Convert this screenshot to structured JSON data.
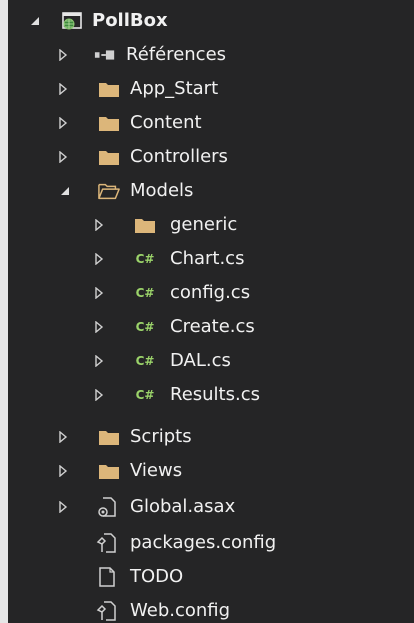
{
  "colors": {
    "background": "#252526",
    "text": "#f1f1f1",
    "folder": "#dcb67a",
    "csharp": "#9bd36a",
    "glyph": "#d0d0d0"
  },
  "tree": {
    "root": {
      "label": "PollBox",
      "icon": "web-project-icon",
      "expanded": true
    },
    "items": [
      {
        "label": "Références",
        "icon": "references-icon",
        "expanded": false
      },
      {
        "label": "App_Start",
        "icon": "folder-icon",
        "expanded": false
      },
      {
        "label": "Content",
        "icon": "folder-icon",
        "expanded": false
      },
      {
        "label": "Controllers",
        "icon": "folder-icon",
        "expanded": false
      },
      {
        "label": "Models",
        "icon": "folder-open-icon",
        "expanded": true
      },
      {
        "label": "generic",
        "icon": "folder-icon",
        "expanded": false
      },
      {
        "label": "Chart.cs",
        "icon": "csharp-file-icon",
        "expanded": false
      },
      {
        "label": "config.cs",
        "icon": "csharp-file-icon",
        "expanded": false
      },
      {
        "label": "Create.cs",
        "icon": "csharp-file-icon",
        "expanded": false
      },
      {
        "label": "DAL.cs",
        "icon": "csharp-file-icon",
        "expanded": false
      },
      {
        "label": "Results.cs",
        "icon": "csharp-file-icon",
        "expanded": false
      },
      {
        "label": "Scripts",
        "icon": "folder-icon",
        "expanded": false
      },
      {
        "label": "Views",
        "icon": "folder-icon",
        "expanded": false
      },
      {
        "label": "Global.asax",
        "icon": "asax-file-icon",
        "expanded": false
      },
      {
        "label": "packages.config",
        "icon": "config-file-icon"
      },
      {
        "label": "TODO",
        "icon": "text-file-icon"
      },
      {
        "label": "Web.config",
        "icon": "config-file-icon"
      }
    ],
    "csharp_badge": "C#"
  }
}
